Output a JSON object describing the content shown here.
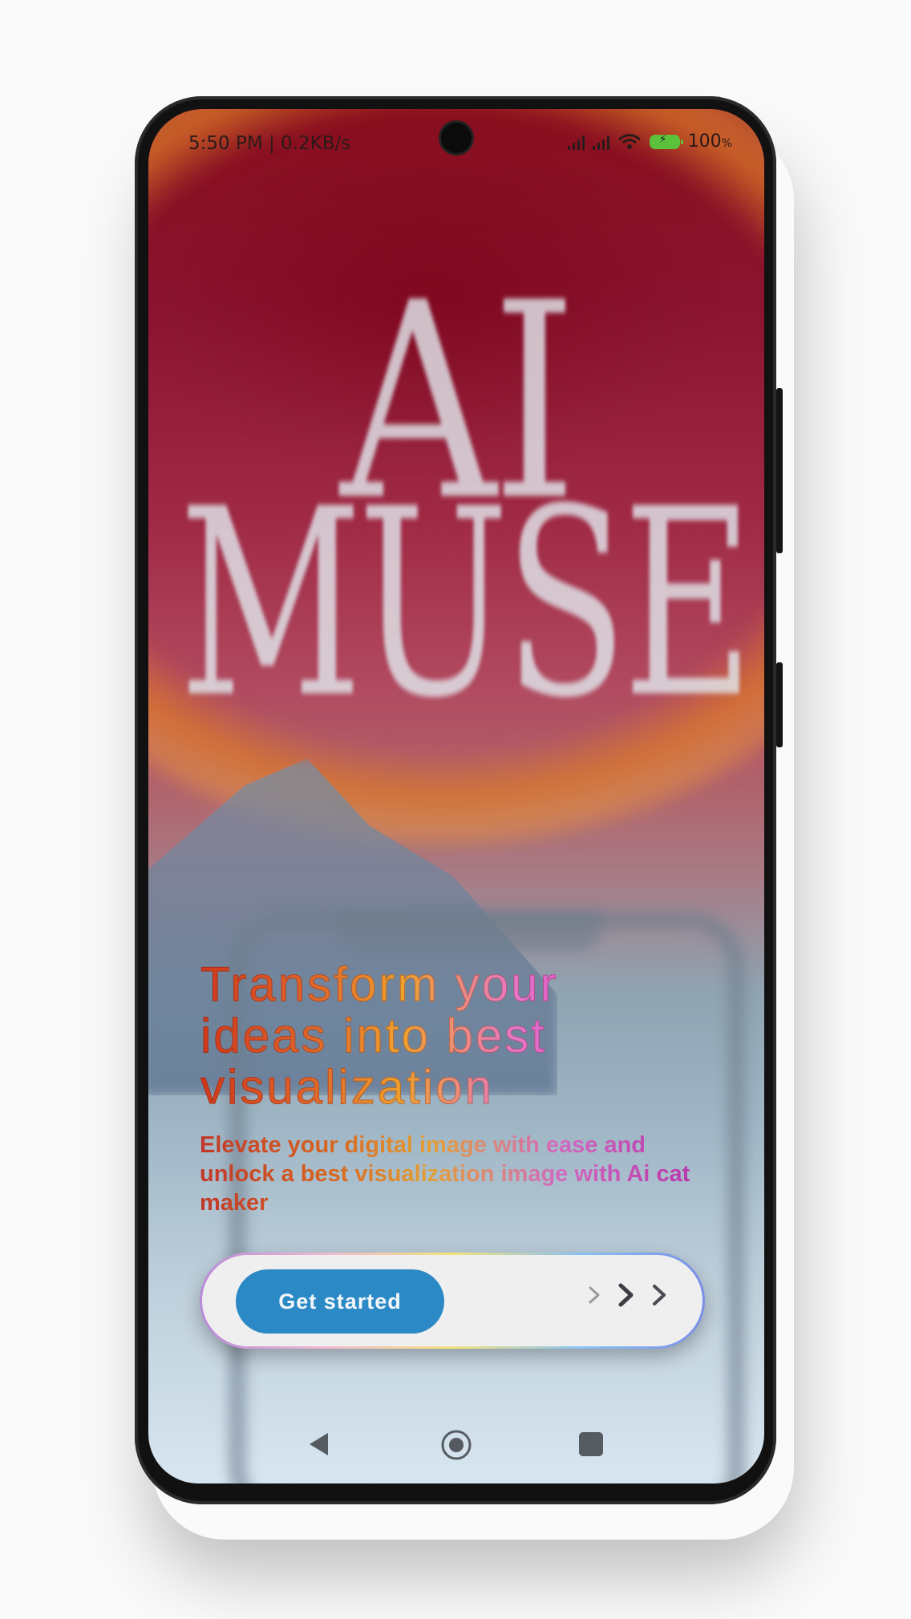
{
  "status_bar": {
    "time_speed": "5:50 PM | 0.2KB/s",
    "battery_level": "100",
    "battery_unit": "%"
  },
  "hero": {
    "brand_line1": "AI",
    "brand_line2": "MUSE"
  },
  "content": {
    "headline": "Transform your ideas into best visualization",
    "subtitle": "Elevate your digital image with ease and unlock a best visualization image with Ai cat maker"
  },
  "cta": {
    "button_label": "Get started"
  },
  "icons": {
    "signal": "signal-bars-icon",
    "wifi": "wifi-icon",
    "battery": "battery-charging-icon",
    "chevrons": "chevron-right-icon",
    "nav_back": "back-triangle-icon",
    "nav_home": "home-circle-icon",
    "nav_recent": "recent-square-icon"
  },
  "colors": {
    "primary_button": "#2b8ac6",
    "battery": "#5cc13b"
  }
}
